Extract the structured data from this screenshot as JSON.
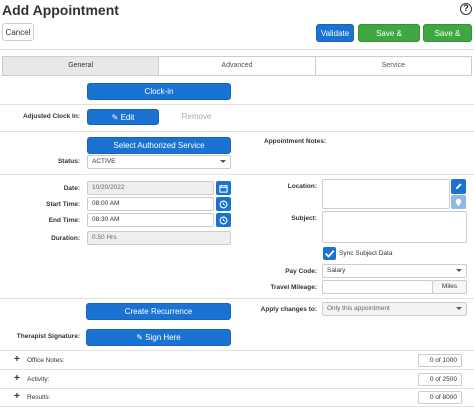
{
  "header": {
    "title": "Add Appointment",
    "help_icon": "help-circle-icon"
  },
  "toolbar": {
    "cancel": "Cancel",
    "validate": "Validate",
    "save_continue": "Save & Continue",
    "save_close": "Save & Close"
  },
  "tabs": [
    {
      "label": "General",
      "active": true
    },
    {
      "label": "Advanced",
      "active": false
    },
    {
      "label": "Service",
      "active": false
    }
  ],
  "clock": {
    "clock_in": "Clock-in",
    "adjusted_label": "Adjusted Clock In:",
    "edit": "Edit",
    "remove": "Remove"
  },
  "service": {
    "select_button": "Select Authorized Service",
    "status_label": "Status:",
    "status_value": "ACTIVE"
  },
  "schedule": {
    "date_label": "Date:",
    "date_value": "10/20/2022",
    "start_label": "Start Time:",
    "start_value": "08:00 AM",
    "end_label": "End Time:",
    "end_value": "08:30 AM",
    "duration_label": "Duration:",
    "duration_value": "0.50 Hrs"
  },
  "right": {
    "notes_label": "Appointment Notes:",
    "location_label": "Location:",
    "subject_label": "Subject:",
    "sync_label": "Sync Subject Data",
    "sync_checked": true,
    "paycode_label": "Pay Code:",
    "paycode_value": "Salary",
    "mileage_label": "Travel Mileage:",
    "mileage_unit": "Miles",
    "apply_label": "Apply changes to:",
    "apply_value": "Only this appointment"
  },
  "actions": {
    "recurrence": "Create Recurrence",
    "signature_label": "Therapist Signature:",
    "sign_here": "Sign Here"
  },
  "accordion": [
    {
      "label": "Office Notes:",
      "counter": "0 of 1000"
    },
    {
      "label": "Activity:",
      "counter": "0 of 2500"
    },
    {
      "label": "Results:",
      "counter": "0 of 8000"
    }
  ],
  "colors": {
    "primary": "#1a73d2",
    "success": "#3fa73f"
  }
}
